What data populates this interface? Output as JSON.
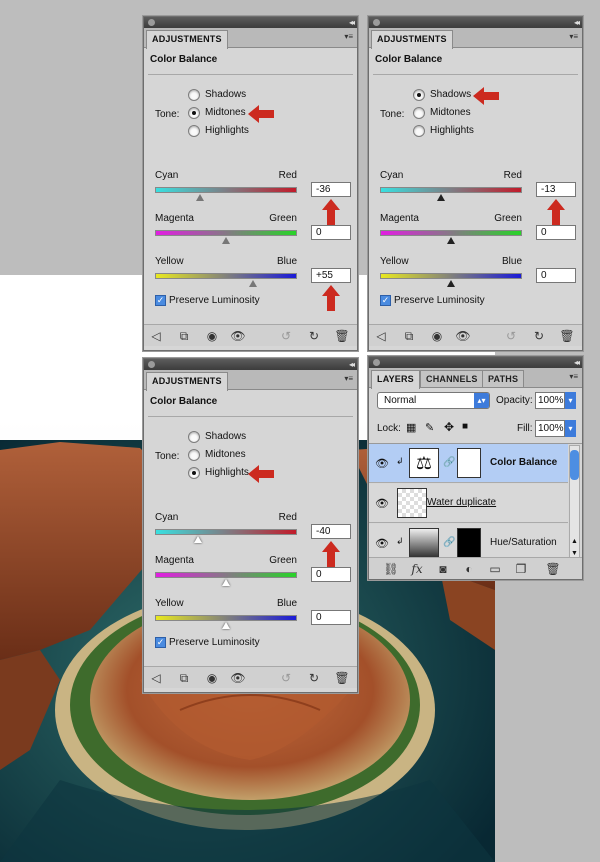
{
  "adjustments_tab": "ADJUSTMENTS",
  "panel_title": "Color Balance",
  "tone_label": "Tone:",
  "tones": [
    "Shadows",
    "Midtones",
    "Highlights"
  ],
  "sliders": {
    "cyan": "Cyan",
    "red": "Red",
    "magenta": "Magenta",
    "green": "Green",
    "yellow": "Yellow",
    "blue": "Blue"
  },
  "preserve_luminosity": "Preserve Luminosity",
  "panels": [
    {
      "selected_tone": "Midtones",
      "values": [
        "-36",
        "0",
        "+55"
      ],
      "levels": [
        0.32,
        0.5,
        0.69
      ]
    },
    {
      "selected_tone": "Shadows",
      "values": [
        "-13",
        "0",
        "0"
      ],
      "levels": [
        0.43,
        0.5,
        0.5
      ]
    },
    {
      "selected_tone": "Highlights",
      "values": [
        "-40",
        "0",
        "0"
      ],
      "levels": [
        0.3,
        0.5,
        0.5
      ]
    }
  ],
  "layers_panel": {
    "tabs": [
      "LAYERS",
      "CHANNELS",
      "PATHS"
    ],
    "blend_mode": "Normal",
    "opacity_label": "Opacity:",
    "opacity_value": "100%",
    "lock_label": "Lock:",
    "fill_label": "Fill:",
    "fill_value": "100%",
    "layers": [
      "Color Balance",
      "Water duplicate",
      "Hue/Saturation"
    ]
  },
  "colors": {
    "panel_bg": "#d6d6d6",
    "selected_layer": "#b3cdf4",
    "arrow": "#cc2a1f",
    "check": "#4a8be0"
  },
  "icons": [
    "back-arrow-icon",
    "clip-icon",
    "visibility-toggle-icon",
    "eye-icon",
    "previous-state-icon",
    "reset-icon",
    "trash-icon",
    "link-icon",
    "fx-icon",
    "mask-icon",
    "adjustment-icon",
    "folder-icon",
    "new-layer-icon",
    "lock-transparent-icon",
    "lock-brush-icon",
    "lock-move-icon",
    "lock-all-icon"
  ]
}
